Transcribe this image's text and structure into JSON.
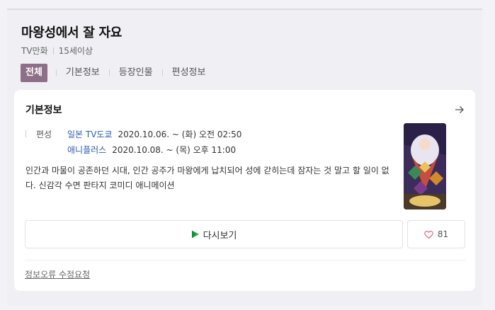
{
  "header": {
    "title": "마왕성에서 잘 자요",
    "category": "TV만화",
    "rating": "15세이상"
  },
  "tabs": [
    {
      "label": "전체",
      "active": true
    },
    {
      "label": "기본정보"
    },
    {
      "label": "등장인물"
    },
    {
      "label": "편성정보"
    }
  ],
  "info": {
    "title": "기본정보",
    "schedule_label": "편성",
    "schedule": [
      {
        "channel": "일본 TV도쿄",
        "time": "2020.10.06. ~  (화) 오전 02:50"
      },
      {
        "channel": "애니플러스",
        "time": "2020.10.08. ~  (목) 오후 11:00"
      }
    ],
    "description": "인간과 마물이 공존하던 시대, 인간 공주가 마왕에게 납치되어 성에 갇히는데 잠자는 것 말고 할 일이 없다. 신감각 수면 판타지 코미디 애니메이션",
    "rewatch_label": "다시보기",
    "like_count": "81",
    "report_label": "정보오류 수정요청"
  },
  "colors": {
    "active_tab": "#8d6f88",
    "link": "#2a5db0",
    "play_green": "#1fb34a",
    "heart": "#e06a7a"
  }
}
